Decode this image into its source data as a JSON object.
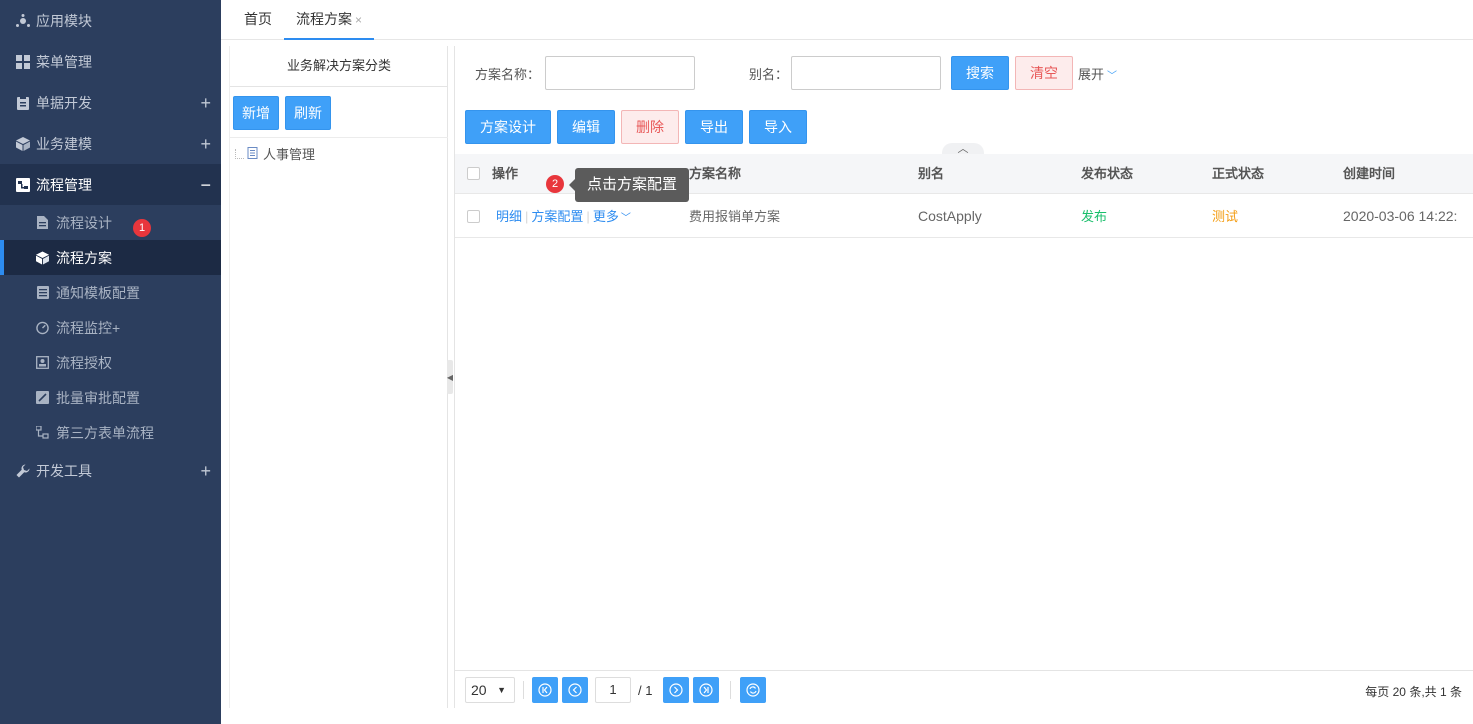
{
  "sidebar": {
    "items": [
      {
        "label": "应用模块",
        "icon": "org-icon",
        "plus": ""
      },
      {
        "label": "菜单管理",
        "icon": "grid-icon",
        "plus": ""
      },
      {
        "label": "单据开发",
        "icon": "clipboard-icon",
        "plus": "+"
      },
      {
        "label": "业务建模",
        "icon": "cube-icon",
        "plus": "+"
      },
      {
        "label": "流程管理",
        "icon": "flow-icon",
        "plus": "−"
      }
    ],
    "subitems": [
      {
        "label": "流程设计",
        "icon": "doc-icon"
      },
      {
        "label": "流程方案",
        "icon": "cube-icon"
      },
      {
        "label": "通知模板配置",
        "icon": "list-icon"
      },
      {
        "label": "流程监控",
        "icon": "gauge-icon"
      },
      {
        "label": "流程授权",
        "icon": "person-card-icon"
      },
      {
        "label": "批量审批配置",
        "icon": "edit-box-icon"
      },
      {
        "label": "第三方表单流程",
        "icon": "hierarchy-icon"
      }
    ],
    "dev_tools": {
      "label": "开发工具",
      "icon": "wrench-icon",
      "plus": "+"
    },
    "badge_1": "1"
  },
  "tabs": [
    {
      "label": "首页"
    },
    {
      "label": "流程方案",
      "close": "×"
    }
  ],
  "tree": {
    "title": "业务解决方案分类",
    "add_label": "新增",
    "refresh_label": "刷新",
    "node_label": "人事管理"
  },
  "search": {
    "name_label": "方案名称：",
    "name_value": "",
    "alias_label": "别名：",
    "alias_value": "",
    "search_label": "搜索",
    "clear_label": "清空",
    "expand_label": "展开"
  },
  "toolbar": {
    "design_label": "方案设计",
    "edit_label": "编辑",
    "delete_label": "删除",
    "export_label": "导出",
    "import_label": "导入"
  },
  "grid": {
    "columns": [
      "操作",
      "方案名称",
      "别名",
      "发布状态",
      "正式状态",
      "创建时间"
    ],
    "rows": [
      {
        "actions": [
          "明细",
          "方案配置",
          "更多"
        ],
        "name": "费用报销单方案",
        "alias": "CostApply",
        "publish_status": "发布",
        "formal_status": "测试",
        "created": "2020-03-06 14:22:"
      }
    ]
  },
  "tooltip": {
    "badge": "2",
    "text": "点击方案配置"
  },
  "pager": {
    "page_size": "20",
    "page_input": "1",
    "total_pages": "/ 1",
    "summary": "每页 20 条,共 1 条"
  },
  "colors": {
    "sidebar_bg": "#2c3e5e",
    "accent": "#2d8cf0",
    "button_blue": "#3fa0f8",
    "publish_green": "#19be6b",
    "test_orange": "#f39c12",
    "badge_red": "#e8363c"
  }
}
